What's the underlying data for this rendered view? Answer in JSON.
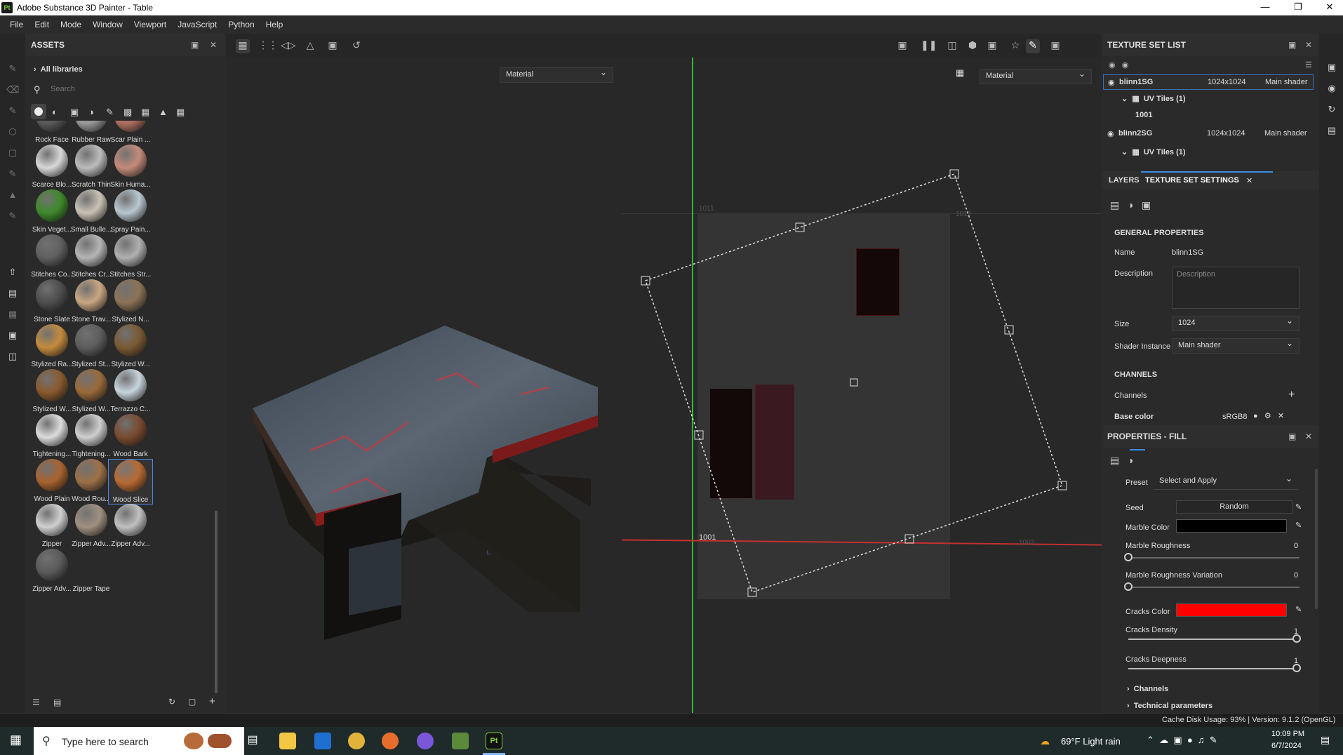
{
  "window": {
    "title": "Adobe Substance 3D Painter - Table",
    "app_icon": "Pt"
  },
  "menu": [
    "File",
    "Edit",
    "Mode",
    "Window",
    "Viewport",
    "JavaScript",
    "Python",
    "Help"
  ],
  "assets": {
    "title": "ASSETS",
    "library": "All libraries",
    "search_placeholder": "Search",
    "items": [
      "Rock Face",
      "Rubber Raw",
      "Scar Plain ...",
      "Scarce Blo...",
      "Scratch Thin",
      "Skin Huma...",
      "Skin Veget...",
      "Small Bulle...",
      "Spray Pain...",
      "Stitches Co...",
      "Stitches Cr...",
      "Stitches Str...",
      "Stone Slate",
      "Stone Trav...",
      "Stylized N...",
      "Stylized Ra...",
      "Stylized St...",
      "Stylized W...",
      "Stylized W...",
      "Stylized W...",
      "Terrazzo C...",
      "Tightening...",
      "Tightening...",
      "Wood Bark",
      "Wood Plain",
      "Wood Rou...",
      "Wood Slice",
      "Zipper",
      "Zipper Adv...",
      "Zipper Adv...",
      "Zipper Adv...",
      "Zipper Tape"
    ],
    "selected": "Wood Slice"
  },
  "viewport": {
    "left_mode": "Material",
    "right_mode": "Material",
    "uv_tiles": [
      "1001",
      "1011",
      "1012",
      "1002"
    ]
  },
  "texture_set_list": {
    "title": "TEXTURE SET LIST",
    "sets": [
      {
        "name": "blinn1SG",
        "size": "1024x1024",
        "shader": "Main shader",
        "uv": "UV Tiles (1)",
        "tile": "1001"
      },
      {
        "name": "blinn2SG",
        "size": "1024x1024",
        "shader": "Main shader",
        "uv": "UV Tiles (1)"
      }
    ]
  },
  "settings": {
    "tab_layers": "LAYERS",
    "tab_settings": "TEXTURE SET SETTINGS",
    "general": "GENERAL PROPERTIES",
    "name_label": "Name",
    "name_value": "blinn1SG",
    "desc_label": "Description",
    "desc_placeholder": "Description",
    "size_label": "Size",
    "size_value": "1024",
    "shader_label": "Shader Instance",
    "shader_value": "Main shader",
    "channels_heading": "CHANNELS",
    "channels_label": "Channels",
    "base_color": "Base color",
    "base_color_format": "sRGB8"
  },
  "properties": {
    "title": "PROPERTIES - FILL",
    "preset_label": "Preset",
    "preset_value": "Select and Apply",
    "seed_label": "Seed",
    "seed_value": "Random",
    "marble_color_label": "Marble Color",
    "marble_roughness_label": "Marble Roughness",
    "marble_roughness_value": "0",
    "marble_rough_var_label": "Marble Roughness Variation",
    "marble_rough_var_value": "0",
    "cracks_color_label": "Cracks Color",
    "cracks_density_label": "Cracks Density",
    "cracks_density_value": "1",
    "cracks_deepness_label": "Cracks Deepness",
    "cracks_deepness_value": "1",
    "channels_section": "Channels",
    "technical_section": "Technical parameters",
    "colors": {
      "marble": "#000000",
      "cracks": "#ff0000"
    }
  },
  "status": {
    "text": "Cache Disk Usage:  93% | Version: 9.1.2 (OpenGL)"
  },
  "taskbar": {
    "search": "Type here to search",
    "weather": "69°F  Light rain",
    "time": "10:09 PM",
    "date": "6/7/2024"
  }
}
